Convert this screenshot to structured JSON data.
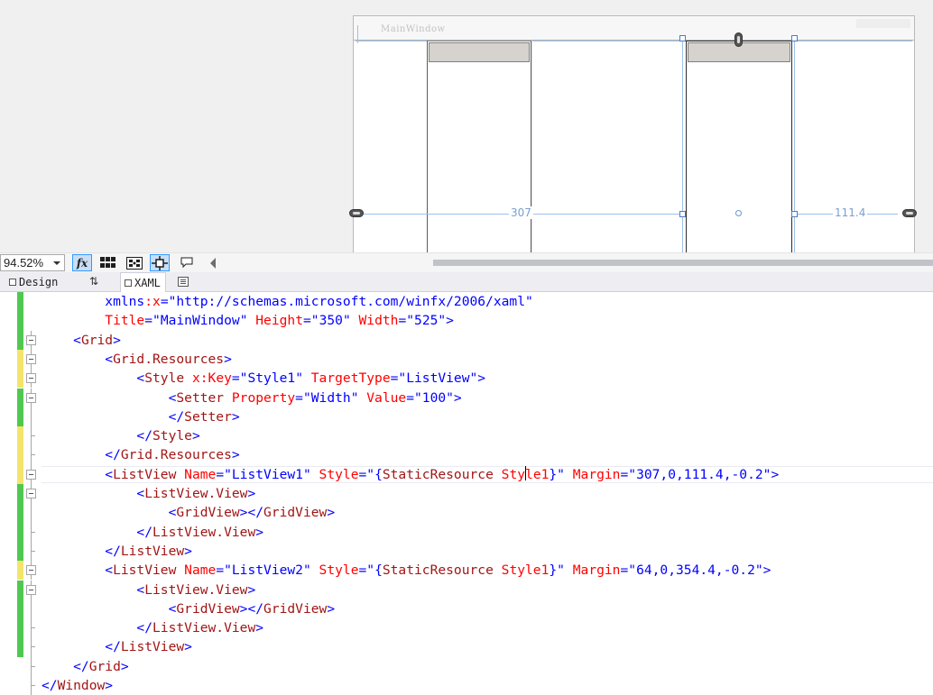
{
  "designer": {
    "window_title": "MainWindow",
    "margin_left_label": "307",
    "margin_right_label": "111.4"
  },
  "toolbar": {
    "zoom": "94.52%"
  },
  "tabs": {
    "design": "Design",
    "swap": "⇅",
    "xaml": "XAML"
  },
  "code": {
    "lines": [
      [
        [
          "b",
          "        xmlns"
        ],
        [
          "b",
          ""
        ],
        [
          "r",
          ":x"
        ],
        [
          "b",
          "=\""
        ],
        [
          "b",
          "http://schemas.microsoft.com/winfx/2006/xaml"
        ],
        [
          "b",
          "\""
        ]
      ],
      [
        [
          "r",
          "        Title"
        ],
        [
          "b",
          "=\""
        ],
        [
          "b",
          "MainWindow"
        ],
        [
          "b",
          "\""
        ],
        [
          "r",
          " Height"
        ],
        [
          "b",
          "=\""
        ],
        [
          "b",
          "350"
        ],
        [
          "b",
          "\""
        ],
        [
          "r",
          " Width"
        ],
        [
          "b",
          "=\""
        ],
        [
          "b",
          "525"
        ],
        [
          "b",
          "\">"
        ]
      ],
      [
        [
          "b",
          "    <"
        ],
        [
          "m",
          "Grid"
        ],
        [
          "b",
          ">"
        ]
      ],
      [
        [
          "b",
          "        <"
        ],
        [
          "m",
          "Grid.Resources"
        ],
        [
          "b",
          ">"
        ]
      ],
      [
        [
          "b",
          "            <"
        ],
        [
          "m",
          "Style"
        ],
        [
          "r",
          " x:Key"
        ],
        [
          "b",
          "=\""
        ],
        [
          "b",
          "Style1"
        ],
        [
          "b",
          "\""
        ],
        [
          "r",
          " TargetType"
        ],
        [
          "b",
          "=\""
        ],
        [
          "b",
          "ListView"
        ],
        [
          "b",
          "\">"
        ]
      ],
      [
        [
          "b",
          "                <"
        ],
        [
          "m",
          "Setter"
        ],
        [
          "r",
          " Property"
        ],
        [
          "b",
          "=\""
        ],
        [
          "b",
          "Width"
        ],
        [
          "b",
          "\""
        ],
        [
          "r",
          " Value"
        ],
        [
          "b",
          "=\""
        ],
        [
          "b",
          "100"
        ],
        [
          "b",
          "\">"
        ]
      ],
      [
        [
          "b",
          "                </"
        ],
        [
          "m",
          "Setter"
        ],
        [
          "b",
          ">"
        ]
      ],
      [
        [
          "b",
          "            </"
        ],
        [
          "m",
          "Style"
        ],
        [
          "b",
          ">"
        ]
      ],
      [
        [
          "b",
          "        </"
        ],
        [
          "m",
          "Grid.Resources"
        ],
        [
          "b",
          ">"
        ]
      ],
      [
        [
          "b",
          "        <"
        ],
        [
          "m",
          "ListView"
        ],
        [
          "r",
          " Name"
        ],
        [
          "b",
          "=\""
        ],
        [
          "b",
          "ListView1"
        ],
        [
          "b",
          "\""
        ],
        [
          "r",
          " Style"
        ],
        [
          "b",
          "=\""
        ],
        [
          "b",
          "{"
        ],
        [
          "m",
          "StaticResource"
        ],
        [
          "r",
          " Sty"
        ],
        [
          "caret",
          ""
        ],
        [
          "r",
          "le1"
        ],
        [
          "b",
          "}\""
        ],
        [
          "r",
          " Margin"
        ],
        [
          "b",
          "=\""
        ],
        [
          "b",
          "307,0,111.4,-0.2"
        ],
        [
          "b",
          "\">"
        ]
      ],
      [
        [
          "b",
          "            <"
        ],
        [
          "m",
          "ListView.View"
        ],
        [
          "b",
          ">"
        ]
      ],
      [
        [
          "b",
          "                <"
        ],
        [
          "m",
          "GridView"
        ],
        [
          "b",
          "></"
        ],
        [
          "m",
          "GridView"
        ],
        [
          "b",
          ">"
        ]
      ],
      [
        [
          "b",
          "            </"
        ],
        [
          "m",
          "ListView.View"
        ],
        [
          "b",
          ">"
        ]
      ],
      [
        [
          "b",
          "        </"
        ],
        [
          "m",
          "ListView"
        ],
        [
          "b",
          ">"
        ]
      ],
      [
        [
          "b",
          "        <"
        ],
        [
          "m",
          "ListView"
        ],
        [
          "r",
          " Name"
        ],
        [
          "b",
          "=\""
        ],
        [
          "b",
          "ListView2"
        ],
        [
          "b",
          "\""
        ],
        [
          "r",
          " Style"
        ],
        [
          "b",
          "=\""
        ],
        [
          "b",
          "{"
        ],
        [
          "m",
          "StaticResource"
        ],
        [
          "r",
          " Style1"
        ],
        [
          "b",
          "}\""
        ],
        [
          "r",
          " Margin"
        ],
        [
          "b",
          "=\""
        ],
        [
          "b",
          "64,0,354.4,-0.2"
        ],
        [
          "b",
          "\">"
        ]
      ],
      [
        [
          "b",
          "            <"
        ],
        [
          "m",
          "ListView.View"
        ],
        [
          "b",
          ">"
        ]
      ],
      [
        [
          "b",
          "                <"
        ],
        [
          "m",
          "GridView"
        ],
        [
          "b",
          "></"
        ],
        [
          "m",
          "GridView"
        ],
        [
          "b",
          ">"
        ]
      ],
      [
        [
          "b",
          "            </"
        ],
        [
          "m",
          "ListView.View"
        ],
        [
          "b",
          ">"
        ]
      ],
      [
        [
          "b",
          "        </"
        ],
        [
          "m",
          "ListView"
        ],
        [
          "b",
          ">"
        ]
      ],
      [
        [
          "b",
          "    </"
        ],
        [
          "m",
          "Grid"
        ],
        [
          "b",
          ">"
        ]
      ],
      [
        [
          "b",
          "</"
        ],
        [
          "m",
          "Window"
        ],
        [
          "b",
          ">"
        ]
      ]
    ],
    "change_marks": [
      "#50c850",
      "#50c850",
      "#50c850",
      "#f4e46a",
      "#f4e46a",
      "#50c850",
      "#50c850",
      "#f4e46a",
      "#f4e46a",
      "#f4e46a",
      "#50c850",
      "#50c850",
      "#50c850",
      "#50c850",
      "#f4e46a",
      "#50c850",
      "#50c850",
      "#50c850",
      "#50c850",
      "#ffffff",
      "#ffffff"
    ],
    "folds": [
      "none",
      "none",
      "open",
      "open",
      "open",
      "open",
      "line",
      "end",
      "end",
      "open",
      "open",
      "line",
      "end",
      "end",
      "open",
      "open",
      "line",
      "end",
      "end",
      "end",
      "end"
    ]
  },
  "colors": {
    "keyword_blue": "#0000ff",
    "element_maroon": "#a31515",
    "attribute_red": "#ff0000",
    "selection_blue": "#3399ff"
  }
}
